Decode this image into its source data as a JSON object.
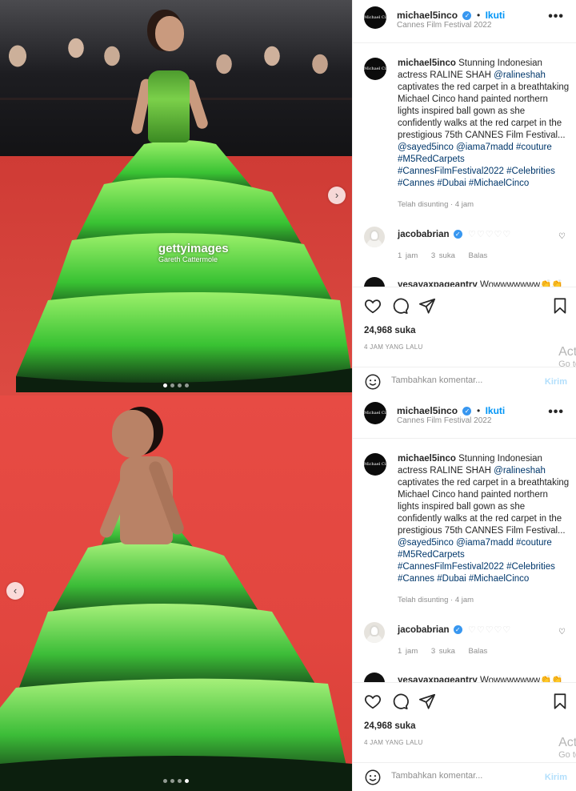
{
  "posts": [
    {
      "header": {
        "username": "michael5inco",
        "follow": "Ikuti",
        "location": "Cannes Film Festival 2022",
        "avatar_text": "Michael Cinco"
      },
      "caption": {
        "username": "michael5inco",
        "text_1": "Stunning Indonesian actress RALINE SHAH ",
        "mention_1": "@ralineshah",
        "text_2": " captivates the red carpet in a breathtaking Michael Cinco hand painted northern lights inspired ball gown as she confidently walks at the red carpet in the prestigious 75th CANNES Film Festival... ",
        "tag_1": "@sayed5inco",
        "tag_2": "@iama7madd",
        "tag_3": "#couture",
        "tag_4": "#M5RedCarpets",
        "tag_5": "#CannesFilmFestival2022",
        "tag_6": "#Celebrities",
        "tag_7": "#Cannes",
        "tag_8": "#Dubai",
        "tag_9": "#MichaelCinco",
        "time": "Telah disunting · 4 jam"
      },
      "comment": {
        "username": "jacobabrian",
        "hearts": "♡♡♡♡♡",
        "time": "1 jam",
        "likes": "3 suka",
        "reply": "Balas"
      },
      "comment2": {
        "username": "yesayaxpageantry",
        "text": "Wowwwwwww👏👏"
      },
      "likes": "24,968 suka",
      "ago": "4 JAM YANG LALU",
      "add_comment_placeholder": "Tambahkan komentar...",
      "send": "Kirim",
      "watermark": {
        "main": "gettyimages",
        "credit": "Gareth Cattermole"
      },
      "nav_icon": "chevron-right-icon"
    },
    {
      "header": {
        "username": "michael5inco",
        "follow": "Ikuti",
        "location": "Cannes Film Festival 2022",
        "avatar_text": "Michael Cinco"
      },
      "caption": {
        "username": "michael5inco",
        "text_1": "Stunning Indonesian actress RALINE SHAH ",
        "mention_1": "@ralineshah",
        "text_2": " captivates the red carpet in a breathtaking Michael Cinco hand painted northern lights inspired ball gown as she confidently walks at the red carpet in the prestigious 75th CANNES Film Festival... ",
        "tag_1": "@sayed5inco",
        "tag_2": "@iama7madd",
        "tag_3": "#couture",
        "tag_4": "#M5RedCarpets",
        "tag_5": "#CannesFilmFestival2022",
        "tag_6": "#Celebrities",
        "tag_7": "#Cannes",
        "tag_8": "#Dubai",
        "tag_9": "#MichaelCinco",
        "time": "Telah disunting · 4 jam"
      },
      "comment": {
        "username": "jacobabrian",
        "hearts": "♡♡♡♡♡",
        "time": "1 jam",
        "likes": "3 suka",
        "reply": "Balas"
      },
      "comment2": {
        "username": "yesayaxpageantry",
        "text": "Wowwwwwww👏👏"
      },
      "likes": "24,968 suka",
      "ago": "4 JAM YANG LALU",
      "add_comment_placeholder": "Tambahkan komentar...",
      "send": "Kirim",
      "nav_icon": "chevron-left-icon"
    }
  ],
  "windows_activation": {
    "line1": "Acti",
    "line2": "Go to"
  },
  "colors": {
    "link": "#00376b",
    "follow": "#0095f6",
    "verified": "#3897f0",
    "carpet": "#d63a34",
    "gown": "#3fbf3a"
  }
}
